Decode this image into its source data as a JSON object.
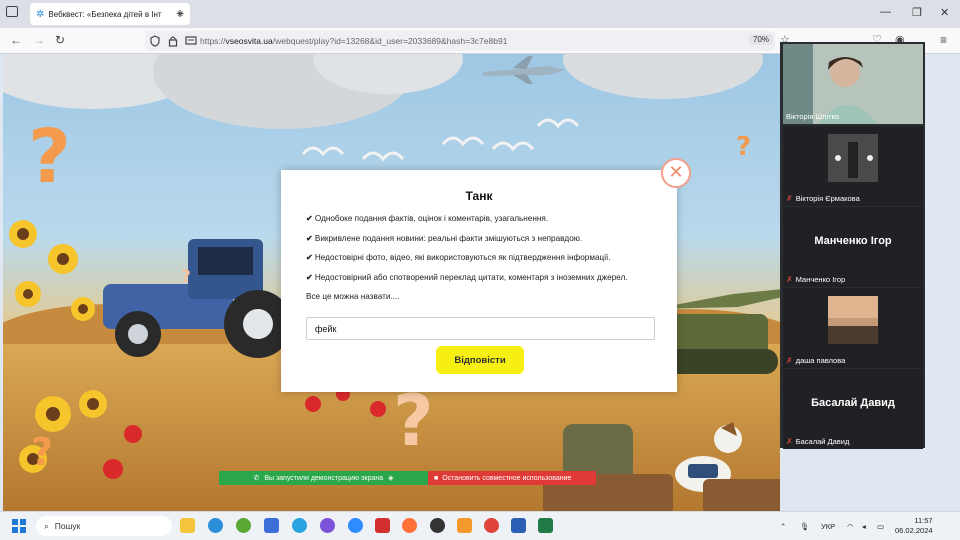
{
  "browser": {
    "tab_title": "Вебквест: «Безпека дітей в Інт",
    "url_prefix": "https://",
    "url_domain": "vseosvita.ua",
    "url_path": "/webquest/play?id=13268&id_user=2033689&hash=3c7e8b91",
    "zoom": "70%"
  },
  "modal": {
    "title": "Танк",
    "check_mark": "✔",
    "items": [
      "Однобоке подання фактів, оцінок і коментарів, узагальнення.",
      "Викривлене подання новини: реальні факти змішуються з неправдою.",
      "Недостовірні фото, відео, які використовуються як підтвердження інформації.",
      "Недостовірний або спотворений переклад цитати, коментаря з іноземних джерел."
    ],
    "note": "Все це можна назвати....",
    "answer_value": "фейк",
    "submit_label": "Відповісти"
  },
  "share_bar": {
    "active_text": "Вы запустили демонстрацию экрана",
    "stop_text": "Остановить совместное использование"
  },
  "participants": [
    {
      "name": "Вікторія Шпітко",
      "muted": false,
      "video": true
    },
    {
      "name": "Вікторія Єрмакова",
      "muted": true,
      "video": true
    },
    {
      "name": "Манченко Ігор",
      "display": "Манченко Ігор",
      "muted": true,
      "video": false
    },
    {
      "name": "даша павлова",
      "muted": true,
      "video": true
    },
    {
      "name": "Басалай Давид",
      "display": "Басалай Давид",
      "muted": true,
      "video": false
    }
  ],
  "taskbar": {
    "search_label": "Пошук",
    "language": "УКР",
    "time": "11:57",
    "date": "06.02.2024"
  },
  "colors": {
    "submit": "#f7ef11",
    "question_mark": "#f49a4d",
    "share_active": "#2aa74a",
    "share_stop": "#e03a36"
  }
}
